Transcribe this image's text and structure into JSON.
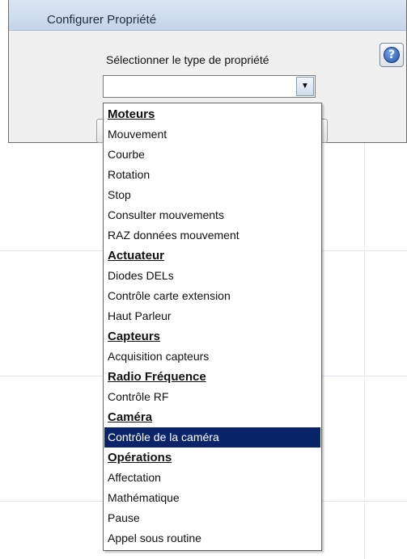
{
  "dialog": {
    "title": "Configurer Propriété",
    "prompt": "Sélectionner le type de propriété",
    "help_label": "?"
  },
  "combo": {
    "value": "",
    "arrow": "▼"
  },
  "dropdown": {
    "selected": "Contrôle de la caméra",
    "items": [
      {
        "label": "Moteurs",
        "kind": "header"
      },
      {
        "label": "Mouvement",
        "kind": "option"
      },
      {
        "label": "Courbe",
        "kind": "option"
      },
      {
        "label": "Rotation",
        "kind": "option"
      },
      {
        "label": "Stop",
        "kind": "option"
      },
      {
        "label": "Consulter mouvements",
        "kind": "option"
      },
      {
        "label": "RAZ données mouvement",
        "kind": "option"
      },
      {
        "label": "Actuateur",
        "kind": "header"
      },
      {
        "label": "Diodes DELs",
        "kind": "option"
      },
      {
        "label": "Contrôle carte extension",
        "kind": "option"
      },
      {
        "label": "Haut Parleur",
        "kind": "option"
      },
      {
        "label": "Capteurs",
        "kind": "header"
      },
      {
        "label": "Acquisition capteurs",
        "kind": "option"
      },
      {
        "label": "Radio Fréquence",
        "kind": "header"
      },
      {
        "label": "Contrôle RF",
        "kind": "option"
      },
      {
        "label": "Caméra",
        "kind": "header"
      },
      {
        "label": "Contrôle de la caméra",
        "kind": "option"
      },
      {
        "label": "Opérations",
        "kind": "header"
      },
      {
        "label": "Affectation",
        "kind": "option"
      },
      {
        "label": "Mathématique",
        "kind": "option"
      },
      {
        "label": "Pause",
        "kind": "option"
      },
      {
        "label": "Appel sous routine",
        "kind": "option"
      }
    ]
  }
}
